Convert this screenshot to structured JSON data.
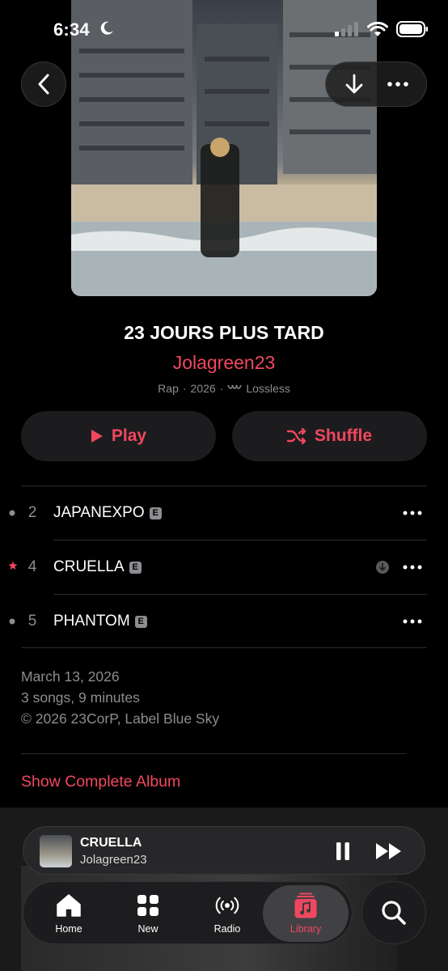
{
  "status_bar": {
    "time": "6:34"
  },
  "album": {
    "title": "23 JOURS PLUS TARD",
    "artist": "Jolagreen23",
    "genre": "Rap",
    "year": "2026",
    "quality": "Lossless"
  },
  "actions": {
    "play_label": "Play",
    "shuffle_label": "Shuffle"
  },
  "tracks": [
    {
      "number": "2",
      "title": "JAPANEXPO",
      "explicit": "E",
      "marker": "dot"
    },
    {
      "number": "4",
      "title": "CRUELLA",
      "explicit": "E",
      "marker": "star",
      "downloaded": true
    },
    {
      "number": "5",
      "title": "PHANTOM",
      "explicit": "E",
      "marker": "dot"
    }
  ],
  "album_info": {
    "release_date": "March 13, 2026",
    "summary": "3 songs, 9 minutes",
    "copyright": "© 2026 23CorP, Label Blue Sky"
  },
  "show_complete_label": "Show Complete Album",
  "now_playing": {
    "title": "CRUELLA",
    "artist": "Jolagreen23"
  },
  "tabs": [
    {
      "label": "Home",
      "icon": "house-icon"
    },
    {
      "label": "New",
      "icon": "grid-icon"
    },
    {
      "label": "Radio",
      "icon": "radio-waves-icon"
    },
    {
      "label": "Library",
      "icon": "music-library-icon",
      "active": true
    }
  ],
  "colors": {
    "accent": "#f0475f",
    "secondary_text": "#8c8c91",
    "surface": "#1c1c1e"
  }
}
